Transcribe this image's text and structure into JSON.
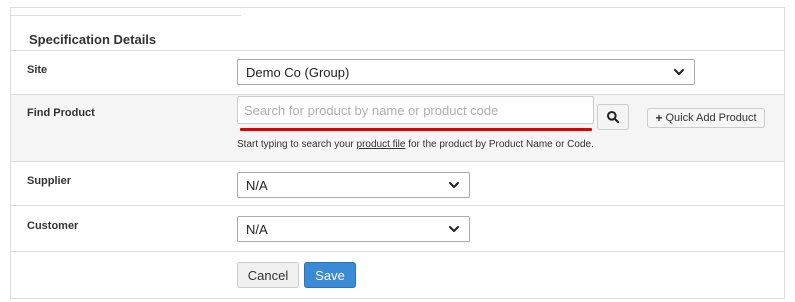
{
  "form": {
    "title": "Specification Details",
    "site": {
      "label": "Site",
      "value": "Demo Co (Group)"
    },
    "find_product": {
      "label": "Find Product",
      "placeholder": "Search for product by name or product code",
      "quick_add_label": "Quick Add Product",
      "help_before": "Start typing to search your ",
      "help_link": "product file",
      "help_after": " for the product by Product Name or Code."
    },
    "supplier": {
      "label": "Supplier",
      "value": "N/A"
    },
    "customer": {
      "label": "Customer",
      "value": "N/A"
    },
    "buttons": {
      "cancel": "Cancel",
      "save": "Save"
    }
  },
  "colors": {
    "accent": "#3a8ad6",
    "underline": "#e00000",
    "row_alt": "#f5f5f5",
    "border": "#dddddd"
  },
  "icons": {
    "search": "search-icon",
    "plus": "plus-icon",
    "chevron": "chevron-down-icon"
  }
}
